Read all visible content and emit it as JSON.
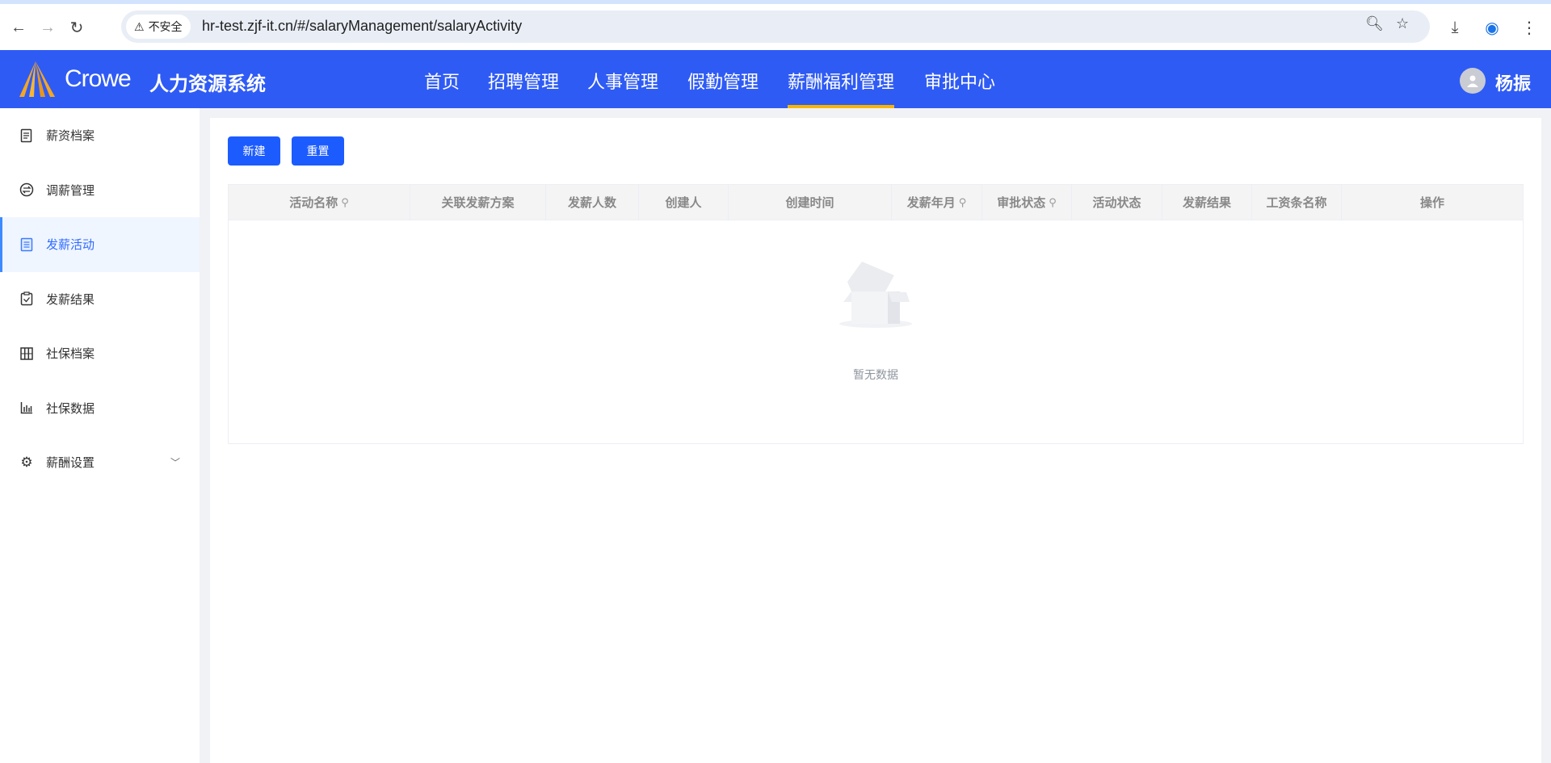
{
  "browser": {
    "security_label": "不安全",
    "url": "hr-test.zjf-it.cn/#/salaryManagement/salaryActivity"
  },
  "header": {
    "brand": "Crowe",
    "system_title": "人力资源系统",
    "nav": [
      "首页",
      "招聘管理",
      "人事管理",
      "假勤管理",
      "薪酬福利管理",
      "审批中心"
    ],
    "active_nav": "薪酬福利管理",
    "user_name": "杨振",
    "accent": "#2f5bf5"
  },
  "sidebar": {
    "items": [
      {
        "label": "薪资档案",
        "icon": "document-icon"
      },
      {
        "label": "调薪管理",
        "icon": "exchange-icon"
      },
      {
        "label": "发薪活动",
        "icon": "clipboard-list-icon"
      },
      {
        "label": "发薪结果",
        "icon": "clipboard-check-icon"
      },
      {
        "label": "社保档案",
        "icon": "columns-icon"
      },
      {
        "label": "社保数据",
        "icon": "bar-chart-icon"
      },
      {
        "label": "薪酬设置",
        "icon": "gear-icon"
      }
    ],
    "active": "发薪活动"
  },
  "toolbar": {
    "new_label": "新建",
    "reset_label": "重置"
  },
  "table": {
    "columns": [
      "活动名称",
      "关联发薪方案",
      "发薪人数",
      "创建人",
      "创建时间",
      "发薪年月",
      "审批状态",
      "活动状态",
      "发薪结果",
      "工资条名称",
      "操作"
    ],
    "empty_text": "暂无数据"
  }
}
